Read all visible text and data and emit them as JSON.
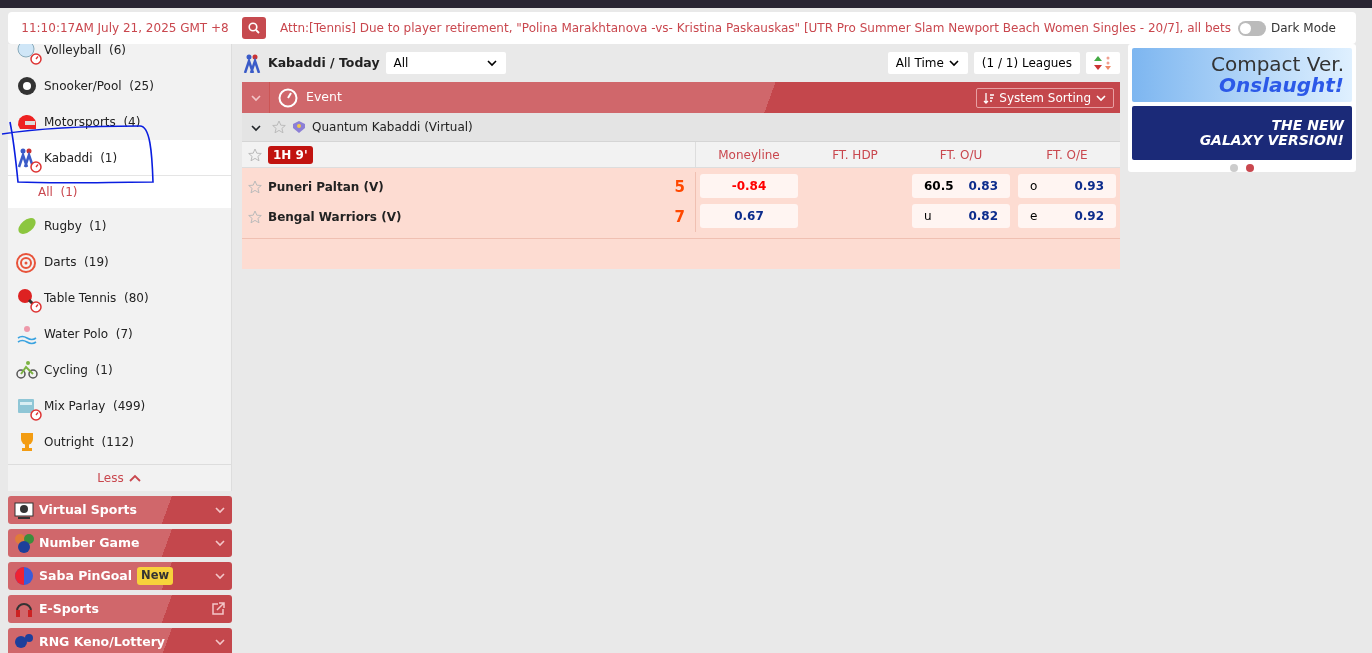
{
  "top_bar": {
    "clock": "11:10:17AM July 21, 2025 GMT +8",
    "notice": "Attn:[Tennis] Due to player retirement, \"Polina Marakhtanova -vs- Kristina Paskauskas\" [UTR Pro Summer Slam Newport Beach Women Singles - 20/7], all bets",
    "dark_mode": {
      "label": "Dark Mode",
      "on": false
    }
  },
  "sidebar": {
    "sports": [
      {
        "kind": "volleyball",
        "name": "Volleyball",
        "count": "(6)",
        "live": true,
        "selected": false
      },
      {
        "kind": "snooker",
        "name": "Snooker/Pool",
        "count": "(25)",
        "live": false,
        "selected": false
      },
      {
        "kind": "motorsports",
        "name": "Motorsports",
        "count": "(4)",
        "live": false,
        "selected": false
      },
      {
        "kind": "kabaddi",
        "name": "Kabaddi",
        "count": "(1)",
        "live": true,
        "selected": true,
        "children": [
          {
            "name": "All",
            "count": "(1)",
            "selected": true
          }
        ]
      },
      {
        "kind": "rugby",
        "name": "Rugby",
        "count": "(1)",
        "live": false,
        "selected": false
      },
      {
        "kind": "darts",
        "name": "Darts",
        "count": "(19)",
        "live": false,
        "selected": false
      },
      {
        "kind": "tabletennis",
        "name": "Table Tennis",
        "count": "(80)",
        "live": true,
        "selected": false
      },
      {
        "kind": "waterpolo",
        "name": "Water Polo",
        "count": "(7)",
        "live": false,
        "selected": false
      },
      {
        "kind": "cycling",
        "name": "Cycling",
        "count": "(1)",
        "live": false,
        "selected": false
      },
      {
        "kind": "parlay",
        "name": "Mix Parlay",
        "count": "(499)",
        "live": true,
        "selected": false
      },
      {
        "kind": "outright",
        "name": "Outright",
        "count": "(112)",
        "live": false,
        "selected": false
      }
    ],
    "less": "Less",
    "sections": [
      {
        "kind": "virtual",
        "label": "Virtual Sports",
        "external": false
      },
      {
        "kind": "number",
        "label": "Number Game",
        "external": false
      },
      {
        "kind": "pingoal",
        "label": "Saba PinGoal",
        "badge": "New",
        "external": false
      },
      {
        "kind": "esports",
        "label": "E-Sports",
        "external": true
      },
      {
        "kind": "keno",
        "label": "RNG Keno/Lottery",
        "external": false
      }
    ]
  },
  "main": {
    "breadcrumb": "Kabaddi / Today",
    "filter": "All",
    "time_filter": "All Time",
    "leagues": "(1 / 1) Leagues",
    "event_label": "Event",
    "sorting": "System Sorting",
    "league": {
      "name": "Quantum Kabaddi (Virtual)",
      "expanded": true,
      "favorite": false
    },
    "match": {
      "time": "1H 9'",
      "columns": [
        "Moneyline",
        "FT. HDP",
        "FT. O/U",
        "FT. O/E"
      ],
      "teams": [
        {
          "name": "Puneri Paltan (V)",
          "score": "5",
          "favorite": false,
          "moneyline": "-0.84",
          "negative": true,
          "ou_label": "60.5",
          "ou": "0.83",
          "oe_label": "o",
          "oe": "0.93"
        },
        {
          "name": "Bengal Warriors (V)",
          "score": "7",
          "favorite": false,
          "moneyline": "0.67",
          "negative": false,
          "ou_label": "u",
          "ou": "0.82",
          "oe_label": "e",
          "oe": "0.92"
        }
      ]
    }
  },
  "banners": {
    "slides": [
      {
        "title": "Compact Ver.",
        "subtitle": "Onslaught!",
        "selected": false
      },
      {
        "title": "THE NEW",
        "subtitle": "GALAXY VERSION!",
        "selected": true
      }
    ]
  }
}
